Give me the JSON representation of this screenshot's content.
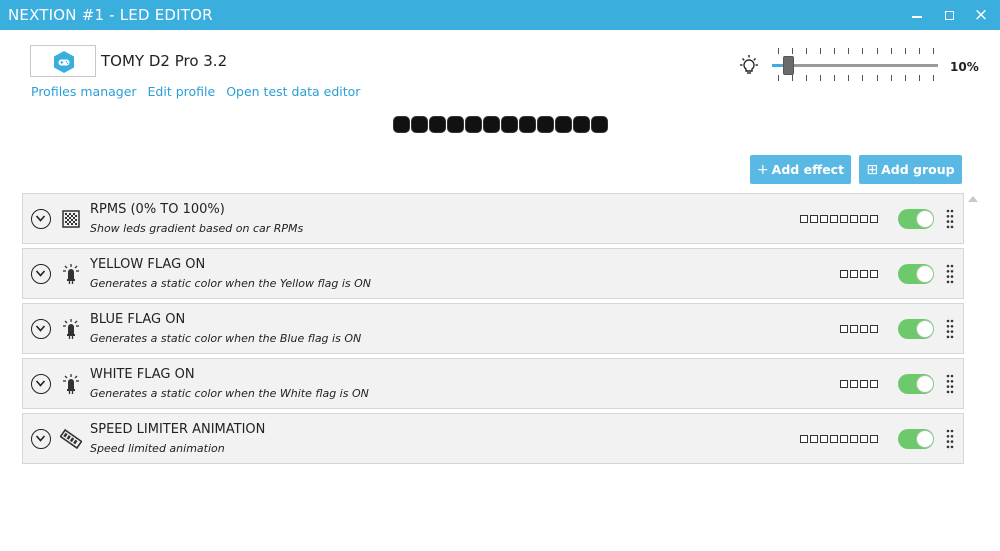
{
  "window": {
    "title": "NEXTION #1 - LED EDITOR",
    "close_glyph": "×"
  },
  "profile": {
    "name": "TOMY D2 Pro 3.2",
    "icon": "gamepad-hex-icon"
  },
  "links": {
    "profiles_manager": "Profiles manager",
    "edit_profile": "Edit profile",
    "open_test_data_editor": "Open test data editor"
  },
  "brightness": {
    "icon": "lightbulb-icon",
    "value": 10,
    "label": "10%"
  },
  "led_preview": {
    "count": 12,
    "color": "#111111"
  },
  "toolbar": {
    "add_effect_icon": "+",
    "add_effect_label": "Add effect",
    "add_group_icon": "⊞",
    "add_group_label": "Add group"
  },
  "effects": [
    {
      "title": "RPMS (0% TO 100%)",
      "description": "Show leds gradient based on car RPMs",
      "icon": "gradient-grid-icon",
      "leds": 8,
      "enabled": true
    },
    {
      "title": "YELLOW FLAG ON",
      "description": "Generates a static color when the Yellow flag is ON",
      "icon": "led-bulb-icon",
      "leds": 4,
      "enabled": true
    },
    {
      "title": "BLUE FLAG ON",
      "description": "Generates a static color when the Blue flag is ON",
      "icon": "led-bulb-icon",
      "leds": 4,
      "enabled": true
    },
    {
      "title": "WHITE FLAG ON",
      "description": "Generates a static color when the White flag is ON",
      "icon": "led-bulb-icon",
      "leds": 4,
      "enabled": true
    },
    {
      "title": "SPEED LIMITER ANIMATION",
      "description": "Speed limited animation",
      "icon": "speed-limiter-icon",
      "leds": 8,
      "enabled": true
    }
  ],
  "colors": {
    "accent": "#3aaedd",
    "button": "#5ab8e4",
    "toggle_on": "#6dc96b",
    "link": "#2a9fd6"
  }
}
